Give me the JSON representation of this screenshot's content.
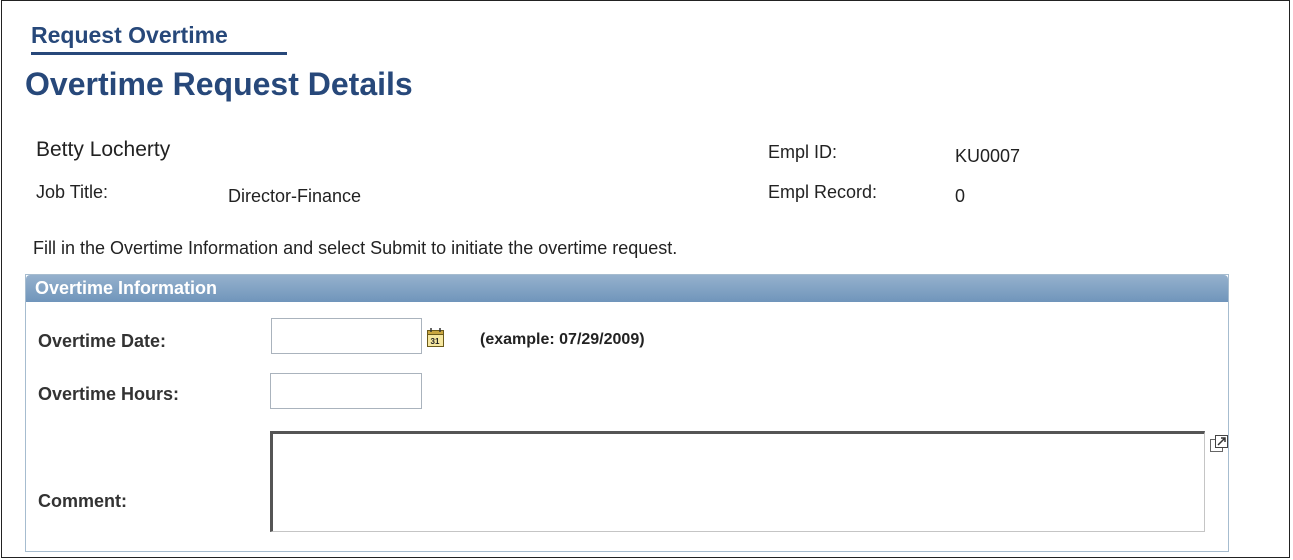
{
  "header": {
    "tab_title": "Request Overtime",
    "page_title": "Overtime Request Details"
  },
  "employee": {
    "name": "Betty Locherty",
    "job_title_label": "Job Title:",
    "job_title_value": "Director-Finance",
    "empl_id_label": "Empl ID:",
    "empl_id_value": "KU0007",
    "empl_record_label": "Empl Record:",
    "empl_record_value": "0"
  },
  "instructions": "Fill in the Overtime Information and select Submit to initiate the overtime request.",
  "overtime_section": {
    "header": "Overtime Information",
    "date_label": "Overtime Date:",
    "date_value": "",
    "date_example": "(example: 07/29/2009)",
    "hours_label": "Overtime Hours:",
    "hours_value": "",
    "comment_label": "Comment:",
    "comment_value": ""
  },
  "icons": {
    "calendar": "calendar-icon",
    "expand": "expand-textarea-icon"
  },
  "colors": {
    "title": "#27487a",
    "section_header": "#7d9fc3"
  }
}
